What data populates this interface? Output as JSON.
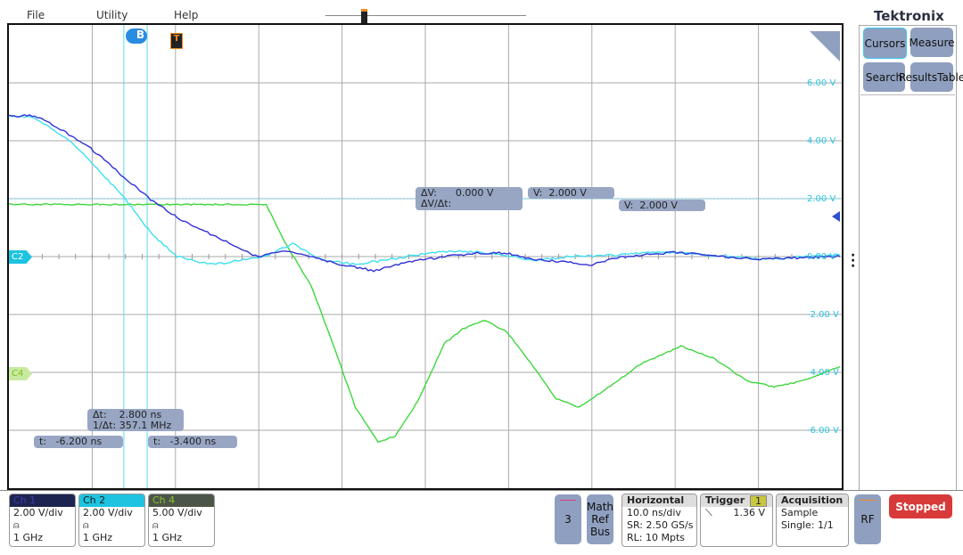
{
  "menu": {
    "file": "File",
    "utility": "Utility",
    "help": "Help"
  },
  "brand": "Tektronix",
  "side_buttons": {
    "cursors": "Cursors",
    "measure": "Measure",
    "search": "Search",
    "results_l1": "Results",
    "results_l2": "Table"
  },
  "markers": {
    "cursor_b": "B",
    "trigger": "T",
    "ch2": "C2",
    "ch4": "C4"
  },
  "y_labels": [
    "6.00 V",
    "4.00 V",
    "2.00 V",
    "0.00 V",
    "-2.00 V",
    "-4.00 V",
    "-6.00 V"
  ],
  "readouts": {
    "dv_label": "ΔV:",
    "dv_value": "0.000 V",
    "dvdt_label": "ΔV/Δt:",
    "v1_label": "V:",
    "v1_value": "2.000 V",
    "v2_label": "V:",
    "v2_value": "2.000 V",
    "dt_label": "Δt:",
    "dt_value": "2.800 ns",
    "inv_dt_label": "1/Δt:",
    "inv_dt_value": "357.1 MHz",
    "t1_label": "t:",
    "t1_value": "-6.200 ns",
    "t2_label": "t:",
    "t2_value": "-3.400 ns"
  },
  "channels": [
    {
      "name": "Ch 1",
      "scale": "2.00 V/div",
      "bw": "1 GHz",
      "color": "#2a2a9a",
      "header": "#1e2450"
    },
    {
      "name": "Ch 2",
      "scale": "2.00 V/div",
      "bw": "1 GHz",
      "color": "#1a1a1a",
      "header": "#1ec3e0"
    },
    {
      "name": "Ch 4",
      "scale": "5.00 V/div",
      "bw": "1 GHz",
      "color": "#7fbf20",
      "header": "#4c5648"
    }
  ],
  "bottom": {
    "ch3": "3",
    "math": "Math",
    "ref": "Ref",
    "bus": "Bus",
    "horizontal": {
      "title": "Horizontal",
      "l1": "10.0 ns/div",
      "l2": "SR: 2.50 GS/s",
      "l3": "RL: 10 Mpts"
    },
    "trigger": {
      "title": "Trigger",
      "source": "1",
      "level": "1.36 V"
    },
    "acquisition": {
      "title": "Acquisition",
      "l1": "Sample",
      "l2": "Single: 1/1"
    },
    "rf": "RF",
    "stopped": "Stopped"
  },
  "waveforms": {
    "time_range_ns": [
      -20,
      80
    ],
    "volt_range": [
      -8,
      8
    ],
    "cursors_t_ns": [
      -6.2,
      -3.4
    ],
    "cursor_v": 2.0,
    "trigger_level_v": 1.36,
    "ch1": {
      "color": "#3030d8",
      "points": [
        [
          -20,
          4.86
        ],
        [
          -16.9,
          4.86
        ],
        [
          -14.8,
          4.58
        ],
        [
          -10.5,
          3.82
        ],
        [
          -6.2,
          2.74
        ],
        [
          -3.0,
          1.97
        ],
        [
          0.2,
          1.35
        ],
        [
          4.5,
          0.74
        ],
        [
          9.9,
          -0.03
        ],
        [
          13.1,
          0.22
        ],
        [
          16.3,
          0
        ],
        [
          19.5,
          -0.25
        ],
        [
          23.8,
          -0.49
        ],
        [
          28.1,
          -0.18
        ],
        [
          32.3,
          0
        ],
        [
          36.6,
          0.12
        ],
        [
          39.8,
          0.12
        ],
        [
          43.0,
          -0.09
        ],
        [
          50.0,
          -0.28
        ],
        [
          53.7,
          0
        ],
        [
          60.2,
          0.15
        ],
        [
          64.5,
          0.03
        ],
        [
          69.8,
          -0.09
        ],
        [
          79.8,
          0
        ]
      ]
    },
    "ch2": {
      "color": "#3fdff0",
      "points": [
        [
          -20,
          4.86
        ],
        [
          -16.9,
          4.8
        ],
        [
          -12.6,
          3.97
        ],
        [
          -9.4,
          3.05
        ],
        [
          -6.2,
          2.06
        ],
        [
          -3.0,
          0.83
        ],
        [
          0.2,
          0
        ],
        [
          4.5,
          -0.28
        ],
        [
          8.8,
          -0.09
        ],
        [
          10.9,
          0.03
        ],
        [
          14.1,
          0.43
        ],
        [
          17.3,
          -0.09
        ],
        [
          21.6,
          -0.28
        ],
        [
          25.9,
          -0.09
        ],
        [
          30.2,
          0.12
        ],
        [
          34.5,
          0.18
        ],
        [
          38.8,
          0.09
        ],
        [
          43.0,
          -0.15
        ],
        [
          47.3,
          0
        ],
        [
          53.7,
          0.06
        ],
        [
          58.0,
          0.18
        ],
        [
          64.5,
          0.03
        ],
        [
          70.9,
          -0.09
        ],
        [
          79.8,
          0.06
        ]
      ]
    },
    "ch4": {
      "color": "#3ed63e",
      "points": [
        [
          -20,
          1.8
        ],
        [
          10.9,
          1.8
        ],
        [
          13.1,
          0.5
        ],
        [
          16.3,
          -1.0
        ],
        [
          19.5,
          -3.5
        ],
        [
          21.6,
          -5.2
        ],
        [
          24.3,
          -6.4
        ],
        [
          26.4,
          -6.2
        ],
        [
          29.1,
          -5.0
        ],
        [
          32.3,
          -3.0
        ],
        [
          34.5,
          -2.5
        ],
        [
          37.2,
          -2.2
        ],
        [
          39.8,
          -2.6
        ],
        [
          43.0,
          -3.8
        ],
        [
          45.7,
          -4.9
        ],
        [
          48.4,
          -5.2
        ],
        [
          51.6,
          -4.6
        ],
        [
          55.9,
          -3.7
        ],
        [
          60.7,
          -3.1
        ],
        [
          64.5,
          -3.5
        ],
        [
          68.7,
          -4.3
        ],
        [
          71.9,
          -4.5
        ],
        [
          75.2,
          -4.3
        ],
        [
          79.8,
          -3.8
        ]
      ]
    }
  }
}
